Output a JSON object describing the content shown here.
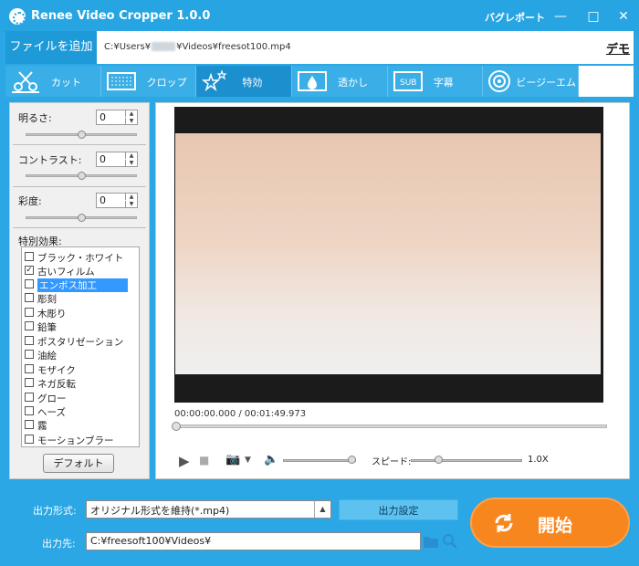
{
  "window": {
    "title": "Renee Video Cropper 1.0.0",
    "bug_report": "バグレポート",
    "min": "—",
    "max": "□",
    "close": "✕"
  },
  "file": {
    "add_button": "ファイルを追加",
    "path_prefix": "C:¥Users¥",
    "path_mid": "¥Videos¥freesot100.mp4",
    "demo_link": "デモ"
  },
  "tabs": [
    {
      "label": "カット",
      "icon": "scissors-icon"
    },
    {
      "label": "クロップ",
      "icon": "crop-icon"
    },
    {
      "label": "特効",
      "icon": "stars-icon"
    },
    {
      "label": "透かし",
      "icon": "watermark-icon"
    },
    {
      "label": "字幕",
      "icon": "subtitle-icon"
    },
    {
      "label": "ビージーエム",
      "icon": "music-icon"
    }
  ],
  "active_tab": "特効",
  "adjust": {
    "brightness": {
      "label": "明るさ:",
      "value": "0"
    },
    "contrast": {
      "label": "コントラスト:",
      "value": "0"
    },
    "saturation": {
      "label": "彩度:",
      "value": "0"
    }
  },
  "effects": {
    "label": "特別効果:",
    "items": [
      {
        "label": "ブラック・ホワイト",
        "checked": false
      },
      {
        "label": "古いフィルム",
        "checked": true
      },
      {
        "label": "エンボス加工",
        "checked": false,
        "selected": true
      },
      {
        "label": "彫刻",
        "checked": false
      },
      {
        "label": "木彫り",
        "checked": false
      },
      {
        "label": "鉛筆",
        "checked": false
      },
      {
        "label": "ポスタリゼーション",
        "checked": false
      },
      {
        "label": "油絵",
        "checked": false
      },
      {
        "label": "モザイク",
        "checked": false
      },
      {
        "label": "ネガ反転",
        "checked": false
      },
      {
        "label": "グロー",
        "checked": false
      },
      {
        "label": "ヘーズ",
        "checked": false
      },
      {
        "label": "霧",
        "checked": false
      },
      {
        "label": "モーションブラー",
        "checked": false
      }
    ],
    "default_button": "デフォルト"
  },
  "player": {
    "timecode": "00:00:00.000 / 00:01:49.973",
    "play": "▶",
    "stop": "■",
    "camera": "📷",
    "camera_dd": "▼",
    "volume": "🔈",
    "speed_label": "スピード:",
    "speed_value": "1.0X",
    "seek_position": 0.0,
    "speed_position": 0.25,
    "volume_level": 0.95
  },
  "output": {
    "format_label": "出力形式:",
    "format_value": "オリジナル形式を維持(*.mp4)",
    "settings_button": "出力設定",
    "dest_label": "出力先:",
    "dest_value": "C:¥freesoft100¥Videos¥",
    "start_button": "開始"
  },
  "colors": {
    "accent": "#27a4e2",
    "start": "#f7861f",
    "selection": "#3399ff"
  }
}
